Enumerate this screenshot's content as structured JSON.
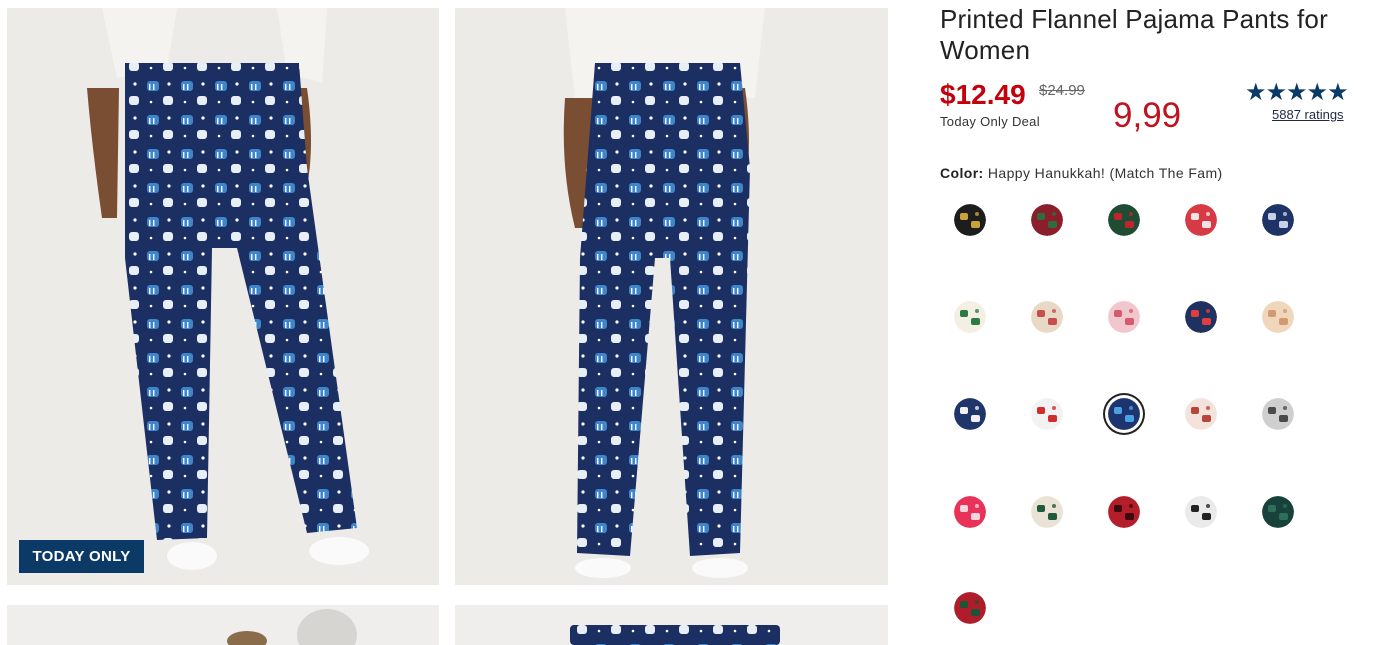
{
  "product": {
    "title": "Printed Flannel Pajama Pants for Women",
    "price": "$12.49",
    "original_price": "$24.99",
    "deal_label": "Today Only Deal",
    "overlay_price": "9,99",
    "stars": "★★★★★",
    "ratings_text": "5887 ratings",
    "color_label": "Color:",
    "color_value": "Happy Hanukkah! (Match The Fam)"
  },
  "gallery": {
    "badge": "TODAY ONLY",
    "images": [
      "pants-front-image",
      "pants-back-image",
      "model-lifestyle-image",
      "pants-flat-image"
    ]
  },
  "colors": {
    "navy": "#1c2f63",
    "price_red": "#c4000c",
    "badge_blue": "#0c3a66",
    "star_blue": "#0a3a67"
  },
  "swatches": [
    {
      "name": "happy-new-year",
      "bg": "#1d1d1d",
      "fg": "#c9a23a"
    },
    {
      "name": "red-trees",
      "bg": "#8a1f2b",
      "fg": "#2e6b3d"
    },
    {
      "name": "green-ornament",
      "bg": "#1f4d33",
      "fg": "#c3242c"
    },
    {
      "name": "red-fairisle",
      "bg": "#d63a45",
      "fg": "#f4e3e3"
    },
    {
      "name": "navy-script",
      "bg": "#1e3466",
      "fg": "#c7d2ea"
    },
    {
      "name": "christmas-tree",
      "bg": "#f3efe3",
      "fg": "#2d7a44"
    },
    {
      "name": "beige-gnome",
      "bg": "#e8d9c6",
      "fg": "#c84d4d"
    },
    {
      "name": "pink-gift",
      "bg": "#f1c6cd",
      "fg": "#d45b6c"
    },
    {
      "name": "santa-navy",
      "bg": "#1e3160",
      "fg": "#e23d3d"
    },
    {
      "name": "beige-plaid",
      "bg": "#f0d6bb",
      "fg": "#d29a73"
    },
    {
      "name": "santa-face-navy",
      "bg": "#20356a",
      "fg": "#f1f1f1"
    },
    {
      "name": "santa-white",
      "bg": "#f2f2f2",
      "fg": "#d12d2d"
    },
    {
      "name": "happy-hanukkah",
      "bg": "#1e3470",
      "fg": "#4aa3e0"
    },
    {
      "name": "red-plaid",
      "bg": "#f3e3dc",
      "fg": "#b8453a"
    },
    {
      "name": "gray-snowflake",
      "bg": "#cfcfcf",
      "fg": "#4a4a4a"
    },
    {
      "name": "pink-candycane",
      "bg": "#e8325a",
      "fg": "#f7d5dd"
    },
    {
      "name": "white-tartan",
      "bg": "#e9e2d5",
      "fg": "#1f5a3a"
    },
    {
      "name": "red-buffalo-check",
      "bg": "#b41e2a",
      "fg": "#3b0a0e"
    },
    {
      "name": "gray-buffalo-check",
      "bg": "#eaeaea",
      "fg": "#222222"
    },
    {
      "name": "green-tartan",
      "bg": "#17413a",
      "fg": "#2f6f57"
    },
    {
      "name": "red-tartan",
      "bg": "#b01d2a",
      "fg": "#1c5436"
    }
  ]
}
